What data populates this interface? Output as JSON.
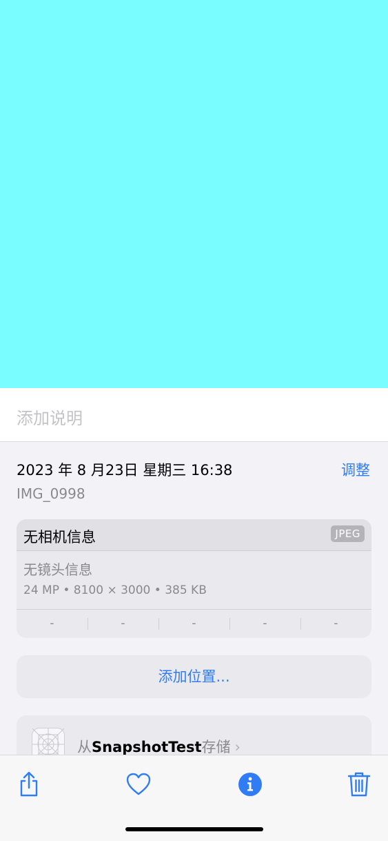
{
  "caption": {
    "placeholder": "添加说明"
  },
  "info": {
    "date": "2023 年 8 月23日 星期三 16:38",
    "adjust_label": "调整",
    "filename": "IMG_0998"
  },
  "camera_card": {
    "camera": "无相机信息",
    "format_badge": "JPEG",
    "lens": "无镜头信息",
    "specs": "24 MP  •  8100 × 3000  •  385 KB",
    "exif": [
      "-",
      "-",
      "-",
      "-",
      "-"
    ]
  },
  "location": {
    "label": "添加位置..."
  },
  "source": {
    "prefix": "从",
    "app": "SnapshotTest",
    "suffix": "存储",
    "chevron": "›"
  },
  "toolbar": {
    "icons": [
      "share-icon",
      "heart-icon",
      "info-icon",
      "trash-icon"
    ],
    "accent": "#2f7cf6"
  },
  "colors": {
    "photo": "#79fdfe",
    "accent": "#2f7cf6"
  }
}
